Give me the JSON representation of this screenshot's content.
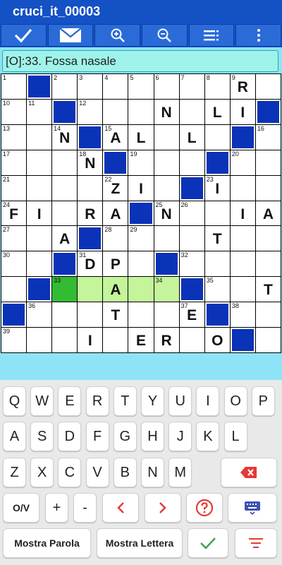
{
  "app": {
    "title": "cruci_it_00003"
  },
  "toolbar": {
    "buttons": [
      {
        "name": "check-icon"
      },
      {
        "name": "mail-icon"
      },
      {
        "name": "zoom-in-icon"
      },
      {
        "name": "zoom-out-icon"
      },
      {
        "name": "list-icon"
      },
      {
        "name": "more-vert-icon"
      }
    ]
  },
  "clue": {
    "text": "[O]:33. Fossa nasale"
  },
  "colors": {
    "accent": "#1451c4",
    "black_cell": "#0a33b8",
    "highlight": "#c4f59a",
    "current": "#33bb33",
    "background": "#8fe3f7",
    "danger": "#e53935"
  },
  "grid": {
    "rows": 11,
    "cols": 11,
    "cells": [
      [
        "1",
        "#",
        "2",
        "3",
        "4",
        "5",
        "6",
        "7",
        "8",
        "9:R",
        ""
      ],
      [
        "10",
        "11",
        "#",
        "12",
        "",
        "",
        "N",
        "",
        "L",
        "I",
        "#"
      ],
      [
        "13",
        "",
        "14:N",
        "#",
        "15:A",
        "L",
        "",
        "L",
        "",
        "#",
        "16"
      ],
      [
        "17",
        "",
        "",
        "18:N",
        "#",
        "19",
        "",
        "",
        "#",
        "20",
        ""
      ],
      [
        "21",
        "",
        "",
        "",
        "22:Z",
        "I",
        "",
        "#",
        "23:I",
        "",
        ""
      ],
      [
        "24:F",
        "I",
        "",
        "R",
        "A",
        "#",
        "25:N",
        "26",
        "",
        "I",
        "A"
      ],
      [
        "27",
        "",
        "A",
        "#",
        "28",
        "29",
        "",
        "",
        "T",
        "",
        ""
      ],
      [
        "30",
        "",
        "#",
        "31:D",
        "P",
        "",
        "#",
        "32",
        "",
        "",
        ""
      ],
      [
        "",
        "#",
        "33",
        "",
        "A",
        "",
        "34",
        "#",
        "35",
        "",
        "T"
      ],
      [
        "#",
        "36",
        "",
        "",
        "T",
        "",
        "",
        "37:E",
        "#",
        "38",
        ""
      ],
      [
        "39",
        "",
        "",
        "I",
        "",
        "E",
        "R",
        "",
        "O",
        "#",
        ""
      ]
    ],
    "highlight": [
      [
        8,
        2
      ],
      [
        8,
        3
      ],
      [
        8,
        4
      ],
      [
        8,
        5
      ],
      [
        8,
        6
      ]
    ],
    "current": [
      8,
      2
    ]
  },
  "keyboard": {
    "row1": [
      "Q",
      "W",
      "E",
      "R",
      "T",
      "Y",
      "U",
      "I",
      "O",
      "P"
    ],
    "row2": [
      "A",
      "S",
      "D",
      "F",
      "G",
      "H",
      "J",
      "K",
      "L"
    ],
    "row3": [
      "Z",
      "X",
      "C",
      "V",
      "B",
      "N",
      "M"
    ],
    "row4": [
      "O/V",
      "+",
      "-"
    ],
    "show_word": "Mostra Parola",
    "show_letter": "Mostra Lettera"
  }
}
